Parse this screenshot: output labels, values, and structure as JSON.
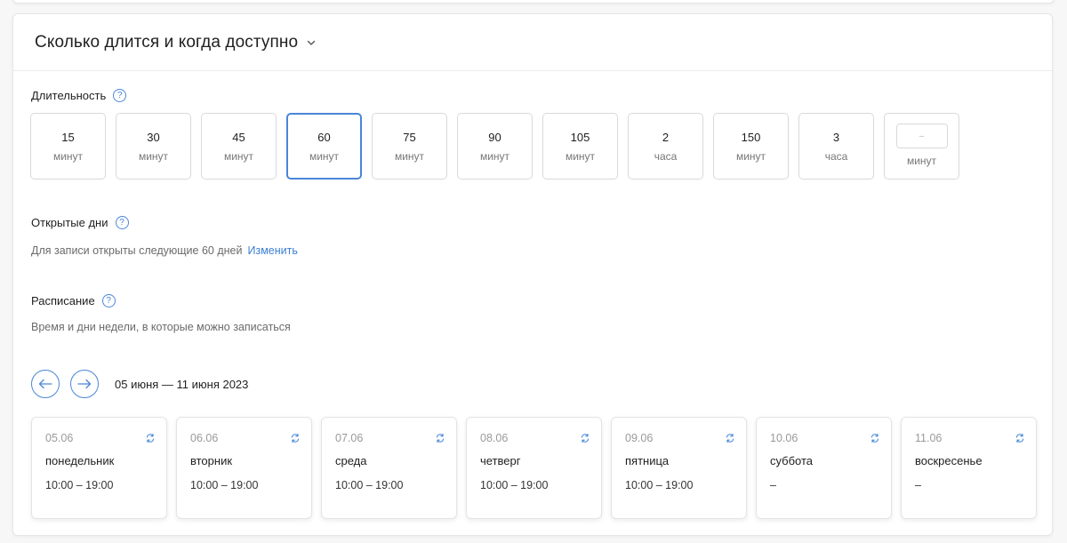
{
  "section": {
    "title": "Сколько длится и когда доступно"
  },
  "duration": {
    "label": "Длительность",
    "help": "?",
    "options": [
      {
        "value": "15",
        "unit": "минут",
        "selected": false
      },
      {
        "value": "30",
        "unit": "минут",
        "selected": false
      },
      {
        "value": "45",
        "unit": "минут",
        "selected": false
      },
      {
        "value": "60",
        "unit": "минут",
        "selected": true
      },
      {
        "value": "75",
        "unit": "минут",
        "selected": false
      },
      {
        "value": "90",
        "unit": "минут",
        "selected": false
      },
      {
        "value": "105",
        "unit": "минут",
        "selected": false
      },
      {
        "value": "2",
        "unit": "часа",
        "selected": false
      },
      {
        "value": "150",
        "unit": "минут",
        "selected": false
      },
      {
        "value": "3",
        "unit": "часа",
        "selected": false
      }
    ],
    "custom": {
      "placeholder": "–",
      "unit": "минут"
    }
  },
  "open_days": {
    "label": "Открытые дни",
    "help": "?",
    "text": "Для записи открыты следующие 60 дней",
    "change_link": "Изменить"
  },
  "schedule": {
    "label": "Расписание",
    "help": "?",
    "text": "Время и дни недели, в которые можно записаться",
    "range": "05 июня — 11 июня 2023",
    "days": [
      {
        "date": "05.06",
        "name": "понедельник",
        "hours": "10:00 – 19:00"
      },
      {
        "date": "06.06",
        "name": "вторник",
        "hours": "10:00 – 19:00"
      },
      {
        "date": "07.06",
        "name": "среда",
        "hours": "10:00 – 19:00"
      },
      {
        "date": "08.06",
        "name": "четверг",
        "hours": "10:00 – 19:00"
      },
      {
        "date": "09.06",
        "name": "пятница",
        "hours": "10:00 – 19:00"
      },
      {
        "date": "10.06",
        "name": "суббота",
        "hours": "–"
      },
      {
        "date": "11.06",
        "name": "воскресенье",
        "hours": "–"
      }
    ]
  },
  "colors": {
    "accent": "#4a86d9",
    "link": "#3b7fd4",
    "muted": "#6b6b6b"
  },
  "icons": {
    "chevron": "chevron-down-icon",
    "help": "help-circle-icon",
    "prev": "arrow-left-icon",
    "next": "arrow-right-icon",
    "repeat": "repeat-icon"
  }
}
